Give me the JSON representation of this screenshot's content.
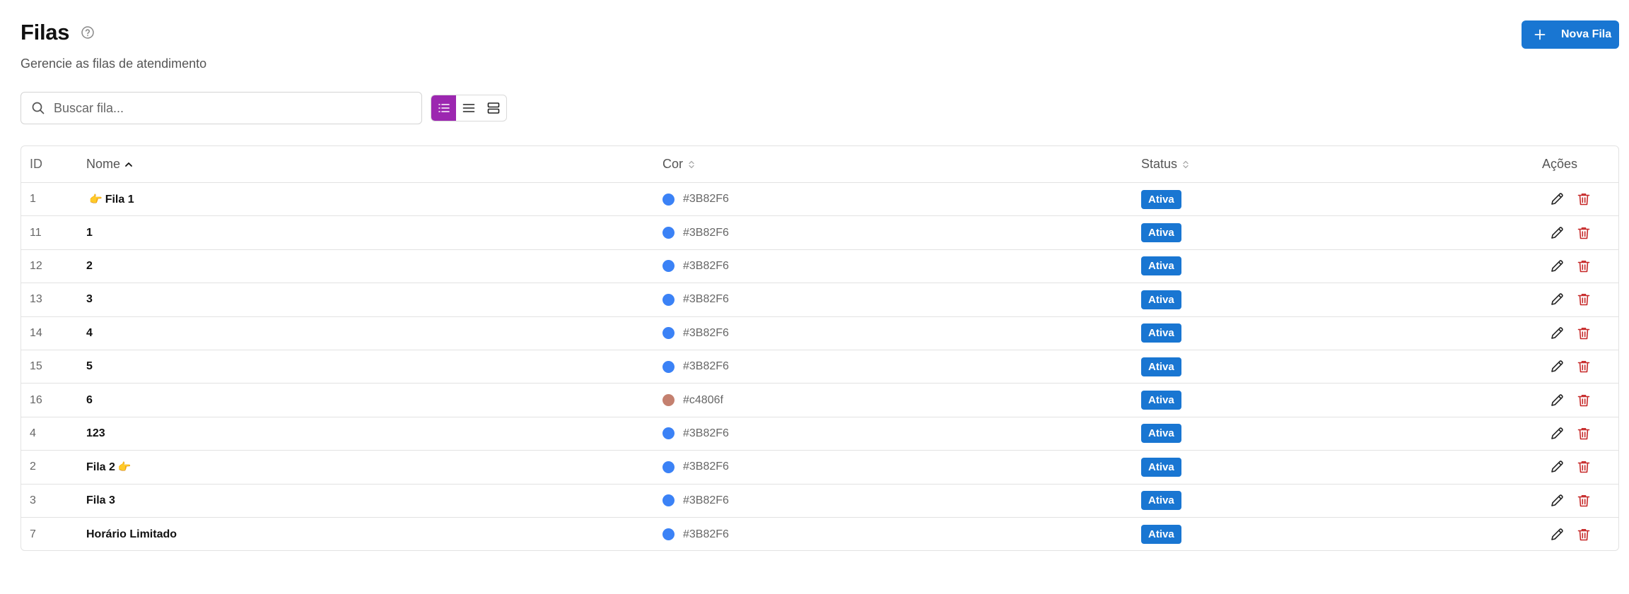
{
  "header": {
    "title": "Filas",
    "subtitle": "Gerencie as filas de atendimento",
    "help_icon": "help-circle-icon"
  },
  "actions": {
    "new_label": "Nova Fila"
  },
  "search": {
    "placeholder": "Buscar fila..."
  },
  "view_modes": [
    "list-detailed",
    "list-compact",
    "cards"
  ],
  "table": {
    "columns": {
      "id": "ID",
      "name": "Nome",
      "color": "Cor",
      "status": "Status",
      "actions": "Ações"
    },
    "sort": {
      "column": "name",
      "direction": "asc"
    },
    "rows": [
      {
        "id": "1",
        "name": "Fila 1",
        "emoji": "👉",
        "emoji_pos": "before",
        "color": "#3B82F6",
        "status": "Ativa"
      },
      {
        "id": "11",
        "name": "1",
        "emoji": "",
        "emoji_pos": "",
        "color": "#3B82F6",
        "status": "Ativa"
      },
      {
        "id": "12",
        "name": "2",
        "emoji": "",
        "emoji_pos": "",
        "color": "#3B82F6",
        "status": "Ativa"
      },
      {
        "id": "13",
        "name": "3",
        "emoji": "",
        "emoji_pos": "",
        "color": "#3B82F6",
        "status": "Ativa"
      },
      {
        "id": "14",
        "name": "4",
        "emoji": "",
        "emoji_pos": "",
        "color": "#3B82F6",
        "status": "Ativa"
      },
      {
        "id": "15",
        "name": "5",
        "emoji": "",
        "emoji_pos": "",
        "color": "#3B82F6",
        "status": "Ativa"
      },
      {
        "id": "16",
        "name": "6",
        "emoji": "",
        "emoji_pos": "",
        "color": "#c4806f",
        "status": "Ativa"
      },
      {
        "id": "4",
        "name": "123",
        "emoji": "",
        "emoji_pos": "",
        "color": "#3B82F6",
        "status": "Ativa"
      },
      {
        "id": "2",
        "name": "Fila 2",
        "emoji": "👉",
        "emoji_pos": "after",
        "color": "#3B82F6",
        "status": "Ativa"
      },
      {
        "id": "3",
        "name": "Fila 3",
        "emoji": "",
        "emoji_pos": "",
        "color": "#3B82F6",
        "status": "Ativa"
      },
      {
        "id": "7",
        "name": "Horário Limitado",
        "emoji": "",
        "emoji_pos": "",
        "color": "#3B82F6",
        "status": "Ativa"
      }
    ]
  },
  "colors": {
    "primary": "#1976d2",
    "view_active": "#9c27b0",
    "delete": "#c62828"
  }
}
